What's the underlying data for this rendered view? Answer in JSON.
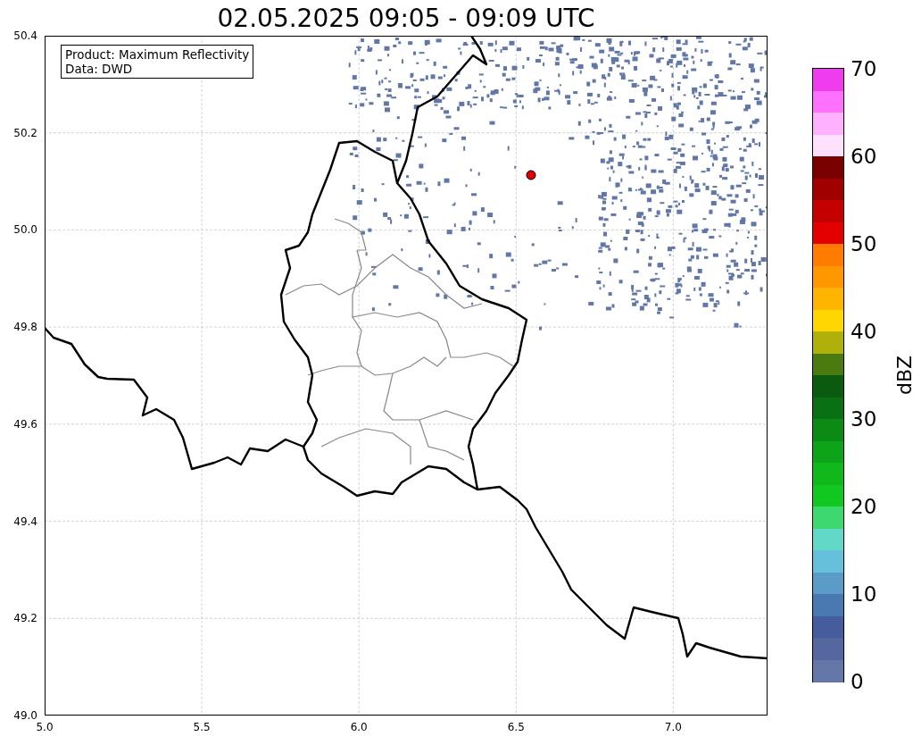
{
  "title": "02.05.2025 09:05 - 09:09 UTC",
  "legend": {
    "lines": [
      "Product: Maximum Reflectivity",
      "Data: DWD"
    ]
  },
  "map": {
    "x_ticks": [
      "5.0",
      "5.5",
      "6.0",
      "6.5",
      "7.0"
    ],
    "y_ticks": [
      "50.4",
      "50.2",
      "50.0",
      "49.8",
      "49.6",
      "49.4",
      "49.2",
      "49.0"
    ]
  },
  "colorbar": {
    "label": "dBZ",
    "ticks": [
      "70",
      "60",
      "50",
      "40",
      "30",
      "20",
      "10",
      "0"
    ],
    "bins": [
      {
        "color": "#ee3cee"
      },
      {
        "color": "#ff70ff"
      },
      {
        "color": "#ffb0ff"
      },
      {
        "color": "#ffe0ff"
      },
      {
        "color": "#7a0000"
      },
      {
        "color": "#a00000"
      },
      {
        "color": "#c40000"
      },
      {
        "color": "#e40000"
      },
      {
        "color": "#ff7c00"
      },
      {
        "color": "#ff9800"
      },
      {
        "color": "#ffb400"
      },
      {
        "color": "#ffd600"
      },
      {
        "color": "#b0b00a"
      },
      {
        "color": "#4a7a10"
      },
      {
        "color": "#0a5a10"
      },
      {
        "color": "#0a7014"
      },
      {
        "color": "#0c8a16"
      },
      {
        "color": "#0ea41a"
      },
      {
        "color": "#10b81c"
      },
      {
        "color": "#10c820"
      },
      {
        "color": "#3ed870"
      },
      {
        "color": "#62d8c8"
      },
      {
        "color": "#66c0dc"
      },
      {
        "color": "#5a9cc8"
      },
      {
        "color": "#4a78b0"
      },
      {
        "color": "#465c9c"
      },
      {
        "color": "#55679f"
      },
      {
        "color": "#6477a8"
      }
    ]
  }
}
